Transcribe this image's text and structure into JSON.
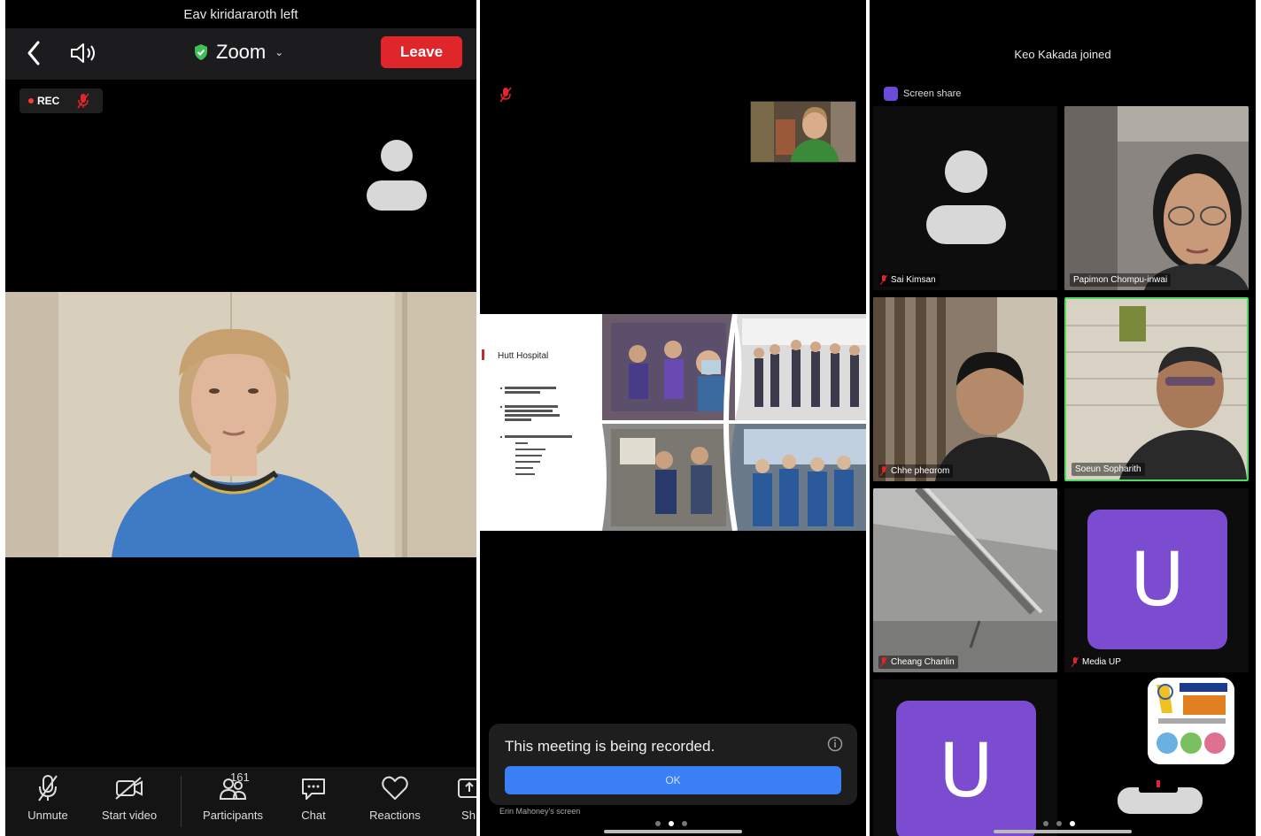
{
  "left_panel": {
    "notification": "Eav kiridararoth left",
    "meeting_title": "Zoom",
    "leave_label": "Leave",
    "rec_label": "REC",
    "toolbar": {
      "unmute": "Unmute",
      "start_video": "Start video",
      "participants": "Participants",
      "participants_count": "161",
      "chat": "Chat",
      "reactions": "Reactions",
      "share_partial": "Sh"
    }
  },
  "middle_panel": {
    "slide": {
      "title": "Hutt Hospital"
    },
    "recording_notice": "This meeting is being recorded.",
    "ok_label": "OK",
    "screen_owner": "Erin Mahoney's screen"
  },
  "right_panel": {
    "notification": "Keo Kakada joined",
    "screen_share_label": "Screen share",
    "participants": [
      {
        "name": "Sai Kimsan",
        "type": "avatar",
        "muted": true
      },
      {
        "name": "Papimon Chompu-inwai",
        "type": "video",
        "muted": false
      },
      {
        "name": "Chhe pheαrom",
        "type": "video",
        "muted": true
      },
      {
        "name": "Soeun Sopharith",
        "type": "video",
        "muted": false,
        "active_speaker": true
      },
      {
        "name": "Cheang Chanlin",
        "type": "video",
        "muted": true
      },
      {
        "name": "Media UP",
        "type": "letter",
        "letter": "U",
        "muted": true
      },
      {
        "name": "",
        "type": "letter",
        "letter": "U",
        "muted": false
      }
    ]
  },
  "colors": {
    "leave_red": "#e0262b",
    "ok_blue": "#3a7ff5",
    "avatar_purple": "#7b4cd0",
    "active_speaker_green": "#4cd964"
  }
}
